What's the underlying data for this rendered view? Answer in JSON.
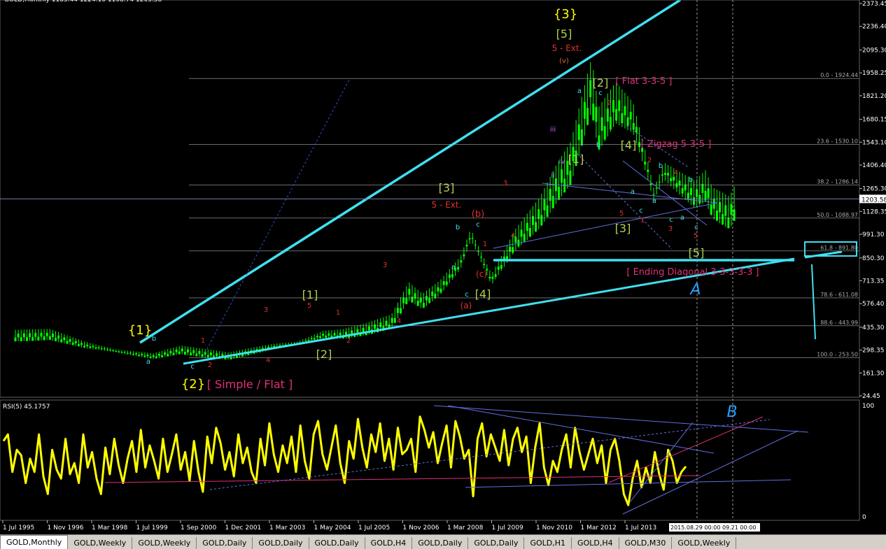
{
  "window": {
    "title": "GOLD,Monthly",
    "ohlc": "1185.44 1224.10 1108.74 1203.58"
  },
  "colors": {
    "background": "#000000",
    "candle": "#00ff00",
    "trendline": "#40e0f0",
    "rsi": "#ffff00",
    "fib": "#aaaaaa",
    "pink": "#e0307a",
    "yellowLabel": "#ffff00",
    "greenLabel": "#b0d050"
  },
  "tabs": [
    {
      "label": "GOLD,Monthly",
      "active": true
    },
    {
      "label": "GOLD,Weekly"
    },
    {
      "label": "GOLD,Weekly"
    },
    {
      "label": "GOLD,Daily"
    },
    {
      "label": "GOLD,Daily"
    },
    {
      "label": "GOLD,Daily"
    },
    {
      "label": "GOLD,H4"
    },
    {
      "label": "GOLD,Daily"
    },
    {
      "label": "GOLD,Daily"
    },
    {
      "label": "GOLD,H1"
    },
    {
      "label": "GOLD,H4"
    },
    {
      "label": "GOLD,M30"
    },
    {
      "label": "GOLD,Weekly"
    }
  ],
  "chart_data": {
    "type": "candlestick",
    "symbol": "GOLD",
    "timeframe": "Monthly",
    "price_axis": {
      "ticks": [
        2373.45,
        2236.4,
        2095.3,
        1958.25,
        1821.2,
        1680.15,
        1543.1,
        1406.4,
        1265.3,
        1128.35,
        991.3,
        850.3,
        713.35,
        576.4,
        435.3,
        298.35,
        161.3,
        24.45
      ],
      "current": 1203.58,
      "ylim": [
        24.45,
        2373.45
      ]
    },
    "time_axis": {
      "labels": [
        "1 Jul 1995",
        "1 Nov 1996",
        "1 Mar 1998",
        "1 Jul 1999",
        "1 Sep 2000",
        "1 Dec 2001",
        "1 Mar 2003",
        "1 May 2004",
        "1 Jul 2005",
        "1 Nov 2006",
        "1 Mar 2008",
        "1 Jul 2009",
        "1 Nov 2010",
        "1 Mar 2012",
        "1 Jul 2013"
      ],
      "highlight": "2015.08.29 00:00 09.21 00:00"
    },
    "price_path": [
      [
        1995,
        385
      ],
      [
        1996,
        392
      ],
      [
        1997,
        330
      ],
      [
        1998,
        290
      ],
      [
        1999,
        262
      ],
      [
        1999.8,
        300
      ],
      [
        2000.3,
        285
      ],
      [
        2001.2,
        262
      ],
      [
        2001.8,
        290
      ],
      [
        2002.5,
        320
      ],
      [
        2003.2,
        340
      ],
      [
        2003.9,
        390
      ],
      [
        2004.5,
        395
      ],
      [
        2005.2,
        425
      ],
      [
        2005.9,
        470
      ],
      [
        2006.4,
        650
      ],
      [
        2006.8,
        590
      ],
      [
        2007.3,
        670
      ],
      [
        2007.9,
        820
      ],
      [
        2008.2,
        990
      ],
      [
        2008.8,
        720
      ],
      [
        2009.5,
        960
      ],
      [
        2010.2,
        1120
      ],
      [
        2010.7,
        1300
      ],
      [
        2011.1,
        1420
      ],
      [
        2011.7,
        1890
      ],
      [
        2011.9,
        1620
      ],
      [
        2012.4,
        1780
      ],
      [
        2012.9,
        1690
      ],
      [
        2013.3,
        1400
      ],
      [
        2013.5,
        1230
      ],
      [
        2013.8,
        1370
      ],
      [
        2014.3,
        1290
      ],
      [
        2014.7,
        1230
      ],
      [
        2015.0,
        1280
      ],
      [
        2015.2,
        1180
      ],
      [
        2015.7,
        1120
      ],
      [
        2015.9,
        1203
      ]
    ],
    "fib_levels": [
      {
        "label": "0.0 - 1924.44",
        "value": 1924.44
      },
      {
        "label": "23.6 - 1530.10",
        "value": 1530.1
      },
      {
        "label": "38.2 - 1286.14",
        "value": 1286.14
      },
      {
        "label": "50.0 - 1088.97",
        "value": 1088.97
      },
      {
        "label": "61.8 - 891.80",
        "value": 891.8
      },
      {
        "label": "78.6 - 611.08",
        "value": 611.08
      },
      {
        "label": "88.6 - 443.99",
        "value": 443.99
      },
      {
        "label": "100.0 - 253.50",
        "value": 253.5
      }
    ],
    "annotations": [
      "{3}",
      "[5]",
      "5 - Ext.",
      "(v)",
      "[2]",
      "[ Flat 3-3-5 ]",
      "[4]",
      "[ Zigzag 5-3-5 ]",
      "[3]",
      "[5]",
      "[ Ending Diagonal 3-3-3-3-3 ]",
      "[3]",
      "5 - Ext.",
      "(b)",
      "(c)",
      "(a)",
      "[4]",
      "[1]",
      "{1}",
      "{2}",
      "[ Simple / Flat ]",
      "[2]",
      "[1]",
      "[3]",
      "A",
      "B"
    ],
    "rsi": {
      "label": "RSI(5) 45.1757",
      "period": 5,
      "last": 45.1757,
      "ylim": [
        0,
        100
      ],
      "values": [
        68,
        74,
        40,
        60,
        55,
        30,
        52,
        40,
        74,
        36,
        20,
        60,
        42,
        34,
        70,
        38,
        48,
        30,
        74,
        44,
        58,
        34,
        20,
        62,
        38,
        70,
        46,
        30,
        52,
        68,
        40,
        78,
        44,
        64,
        50,
        34,
        70,
        40,
        56,
        74,
        42,
        58,
        32,
        68,
        40,
        22,
        72,
        48,
        80,
        66,
        42,
        58,
        36,
        74,
        48,
        62,
        40,
        30,
        70,
        46,
        84,
        56,
        40,
        64,
        48,
        72,
        40,
        82,
        50,
        34,
        74,
        86,
        56,
        42,
        62,
        82,
        48,
        30,
        68,
        52,
        88,
        62,
        44,
        74,
        58,
        84,
        50,
        70,
        42,
        80,
        56,
        60,
        70,
        40,
        90,
        78,
        62,
        76,
        48,
        66,
        82,
        44,
        86,
        72,
        52,
        60,
        18,
        70,
        84,
        54,
        74,
        62,
        50,
        78,
        46,
        70,
        80,
        58,
        72,
        30,
        62,
        84,
        44,
        28,
        50,
        40,
        60,
        74,
        44,
        80,
        58,
        42,
        56,
        70,
        48,
        64,
        30,
        60,
        70,
        50,
        20,
        10,
        34,
        50,
        26,
        44,
        30,
        58,
        38,
        24,
        60,
        50,
        30,
        40,
        45
      ]
    }
  }
}
